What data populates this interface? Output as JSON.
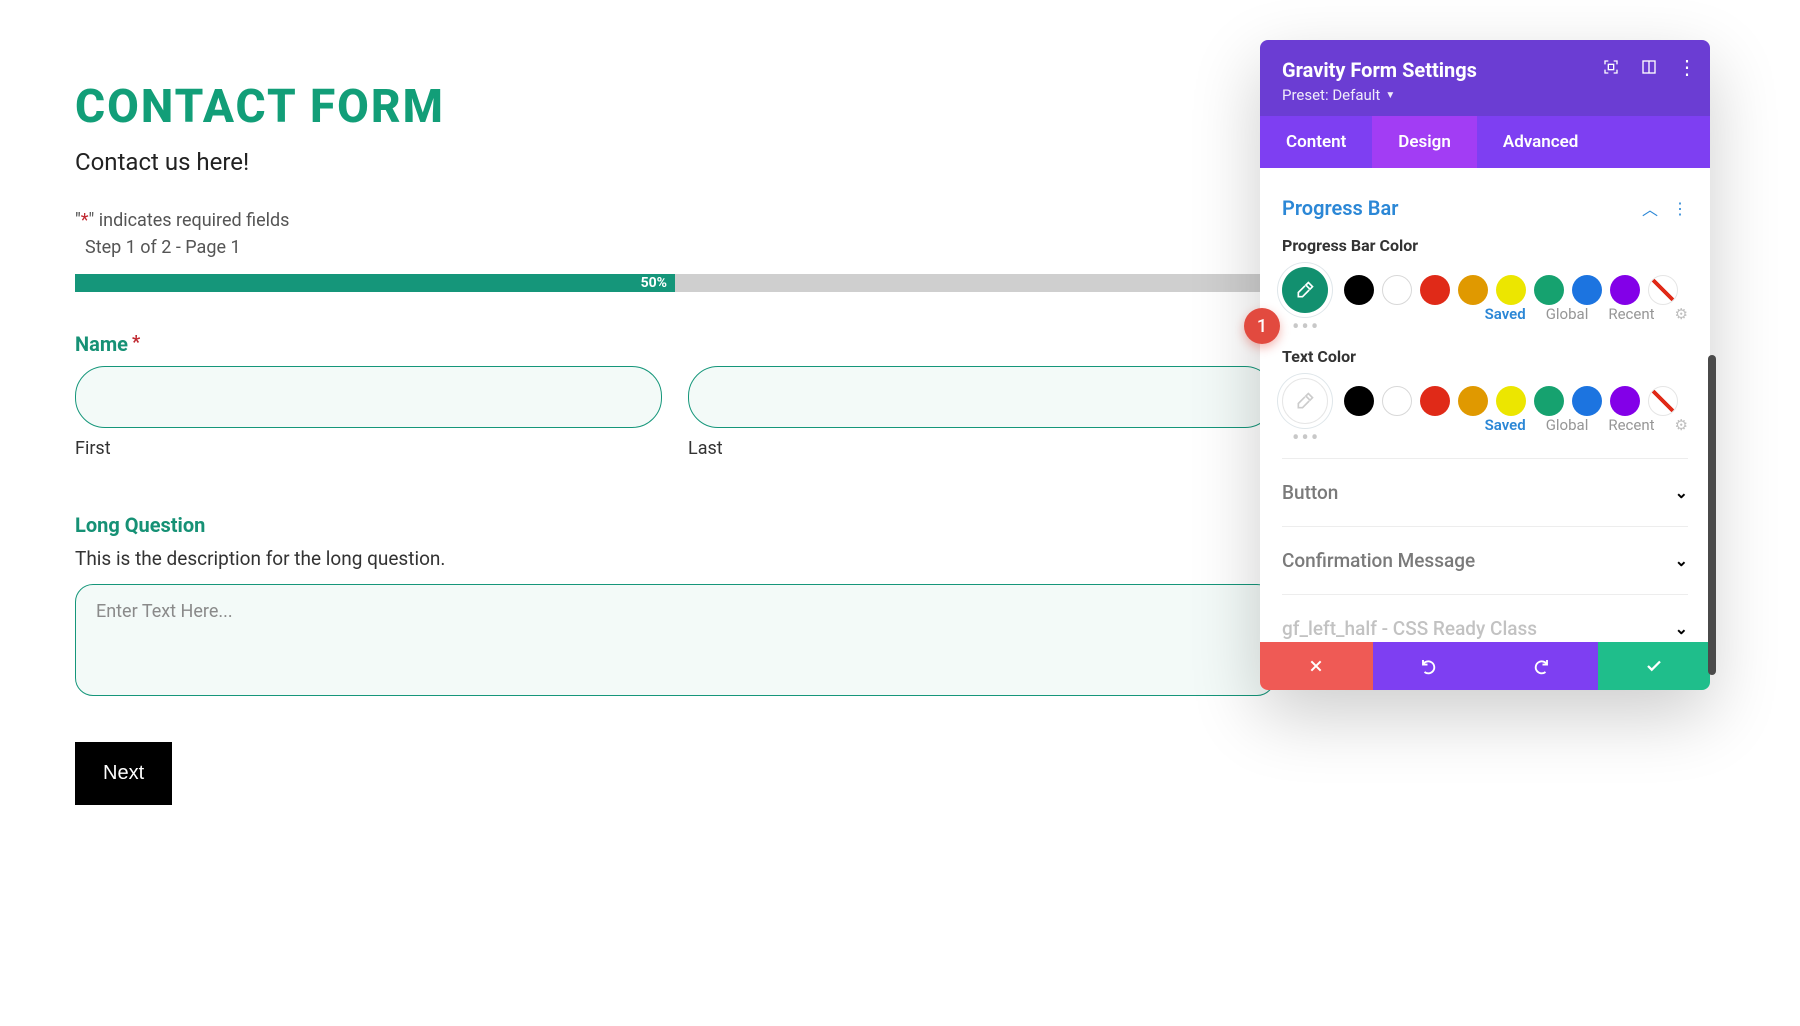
{
  "form": {
    "title": "CONTACT FORM",
    "subtitle": "Contact us here!",
    "required_prefix_quote": "\"",
    "required_star": "*",
    "required_suffix": "\" indicates required fields",
    "step_text": "Step 1 of 2 - Page 1",
    "progress_percent": "50%",
    "name": {
      "label": "Name",
      "required_mark": "*",
      "first_sub": "First",
      "last_sub": "Last"
    },
    "long_q": {
      "label": "Long Question",
      "desc": "This is the description for the long question.",
      "placeholder": "Enter Text Here..."
    },
    "next_label": "Next"
  },
  "panel": {
    "title": "Gravity Form Settings",
    "preset_label": "Preset: Default",
    "tabs": {
      "content": "Content",
      "design": "Design",
      "advanced": "Advanced"
    },
    "sections": {
      "progress_bar": {
        "title": "Progress Bar",
        "color_label": "Progress Bar Color",
        "text_color_label": "Text Color"
      },
      "button": "Button",
      "confirmation": "Confirmation Message",
      "css_class": "gf_left_half - CSS Ready Class"
    },
    "filters": {
      "saved": "Saved",
      "global": "Global",
      "recent": "Recent"
    },
    "swatch_lead_colors": {
      "progress": "#12906f",
      "text": "#ffffff"
    },
    "palette": [
      "#000000",
      "#ffffff",
      "#e02a18",
      "#e09900",
      "#ece600",
      "#16a26f",
      "#1c74e0",
      "#8300e8",
      "hatch"
    ]
  },
  "annotation": {
    "badge_1": "1"
  }
}
